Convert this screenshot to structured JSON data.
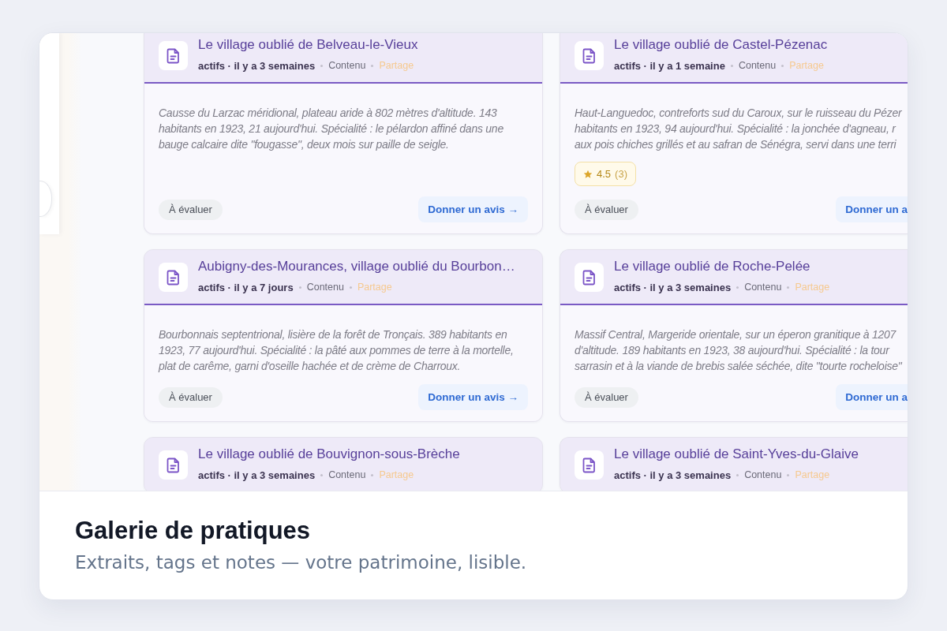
{
  "gallery": {
    "cards": [
      {
        "title": "Le village oublié de Belveau-le-Vieux",
        "meta": "actifs · il y a 3 semaines",
        "tags": [
          {
            "label": "Contenu",
            "color": "#6b6a78"
          },
          {
            "label": "Partage",
            "color": "#f6c98f"
          }
        ],
        "description": [
          "Causse du Larzac méridional, plateau aride à 802 mètres d'altitude. 143",
          "habitants en 1923, 21 aujourd'hui. Spécialité : le pélardon affiné dans une",
          "bauge calcaire dite \"fougasse\", deux mois sur paille de seigle."
        ],
        "status": "À évaluer",
        "action": "Donner un avis →"
      },
      {
        "title": "Le village oublié de Castel-Pézenac",
        "meta": "actifs · il y a 1 semaine",
        "tags": [
          {
            "label": "Contenu",
            "color": "#6b6a78"
          },
          {
            "label": "Partage",
            "color": "#f6c98f"
          }
        ],
        "description": [
          "Haut-Languedoc, contreforts sud du Caroux, sur le ruisseau du Pézer",
          "habitants en 1923, 94 aujourd'hui. Spécialité : la jonchée d'agneau, r",
          "aux pois chiches grillés et au safran de Sénégra, servi dans une terri"
        ],
        "rating": {
          "value": "4.5",
          "count": "(3)"
        },
        "status": "À évaluer",
        "action": "Donner un a"
      },
      {
        "title": "Aubigny-des-Mourances, village oublié du Bourbon…",
        "meta": "actifs · il y a 7 jours",
        "tags": [
          {
            "label": "Contenu",
            "color": "#6b6a78"
          },
          {
            "label": "Partage",
            "color": "#f6c98f"
          }
        ],
        "description": [
          "Bourbonnais septentrional, lisière de la forêt de Tronçais. 389 habitants en",
          "1923, 77 aujourd'hui. Spécialité : la pâté aux pommes de terre à la mortelle,",
          "plat de carême, garni d'oseille hachée et de crème de Charroux."
        ],
        "status": "À évaluer",
        "action": "Donner un avis →"
      },
      {
        "title": "Le village oublié de Roche-Pelée",
        "meta": "actifs · il y a 3 semaines",
        "tags": [
          {
            "label": "Contenu",
            "color": "#6b6a78"
          },
          {
            "label": "Partage",
            "color": "#f6c98f"
          }
        ],
        "description": [
          "Massif Central, Margeride orientale, sur un éperon granitique à 1207",
          "d'altitude. 189 habitants en 1923, 38 aujourd'hui. Spécialité : la tour",
          "sarrasin et à la viande de brebis salée séchée, dite \"tourte rocheloise\""
        ],
        "status": "À évaluer",
        "action": "Donner un a"
      },
      {
        "title": "Le village oublié de Bouvignon-sous-Brèche",
        "meta": "actifs · il y a 3 semaines",
        "tags": [
          {
            "label": "Contenu",
            "color": "#6b6a78"
          },
          {
            "label": "Partage",
            "color": "#f6c98f"
          }
        ]
      },
      {
        "title": "Le village oublié de Saint-Yves-du-Glaive",
        "meta": "actifs · il y a 3 semaines",
        "tags": [
          {
            "label": "Contenu",
            "color": "#6b6a78"
          },
          {
            "label": "Partage",
            "color": "#f6c98f"
          }
        ]
      }
    ]
  },
  "caption": {
    "title": "Galerie de pratiques",
    "subtitle": "Extraits, tags et notes — votre patrimoine, lisible."
  }
}
